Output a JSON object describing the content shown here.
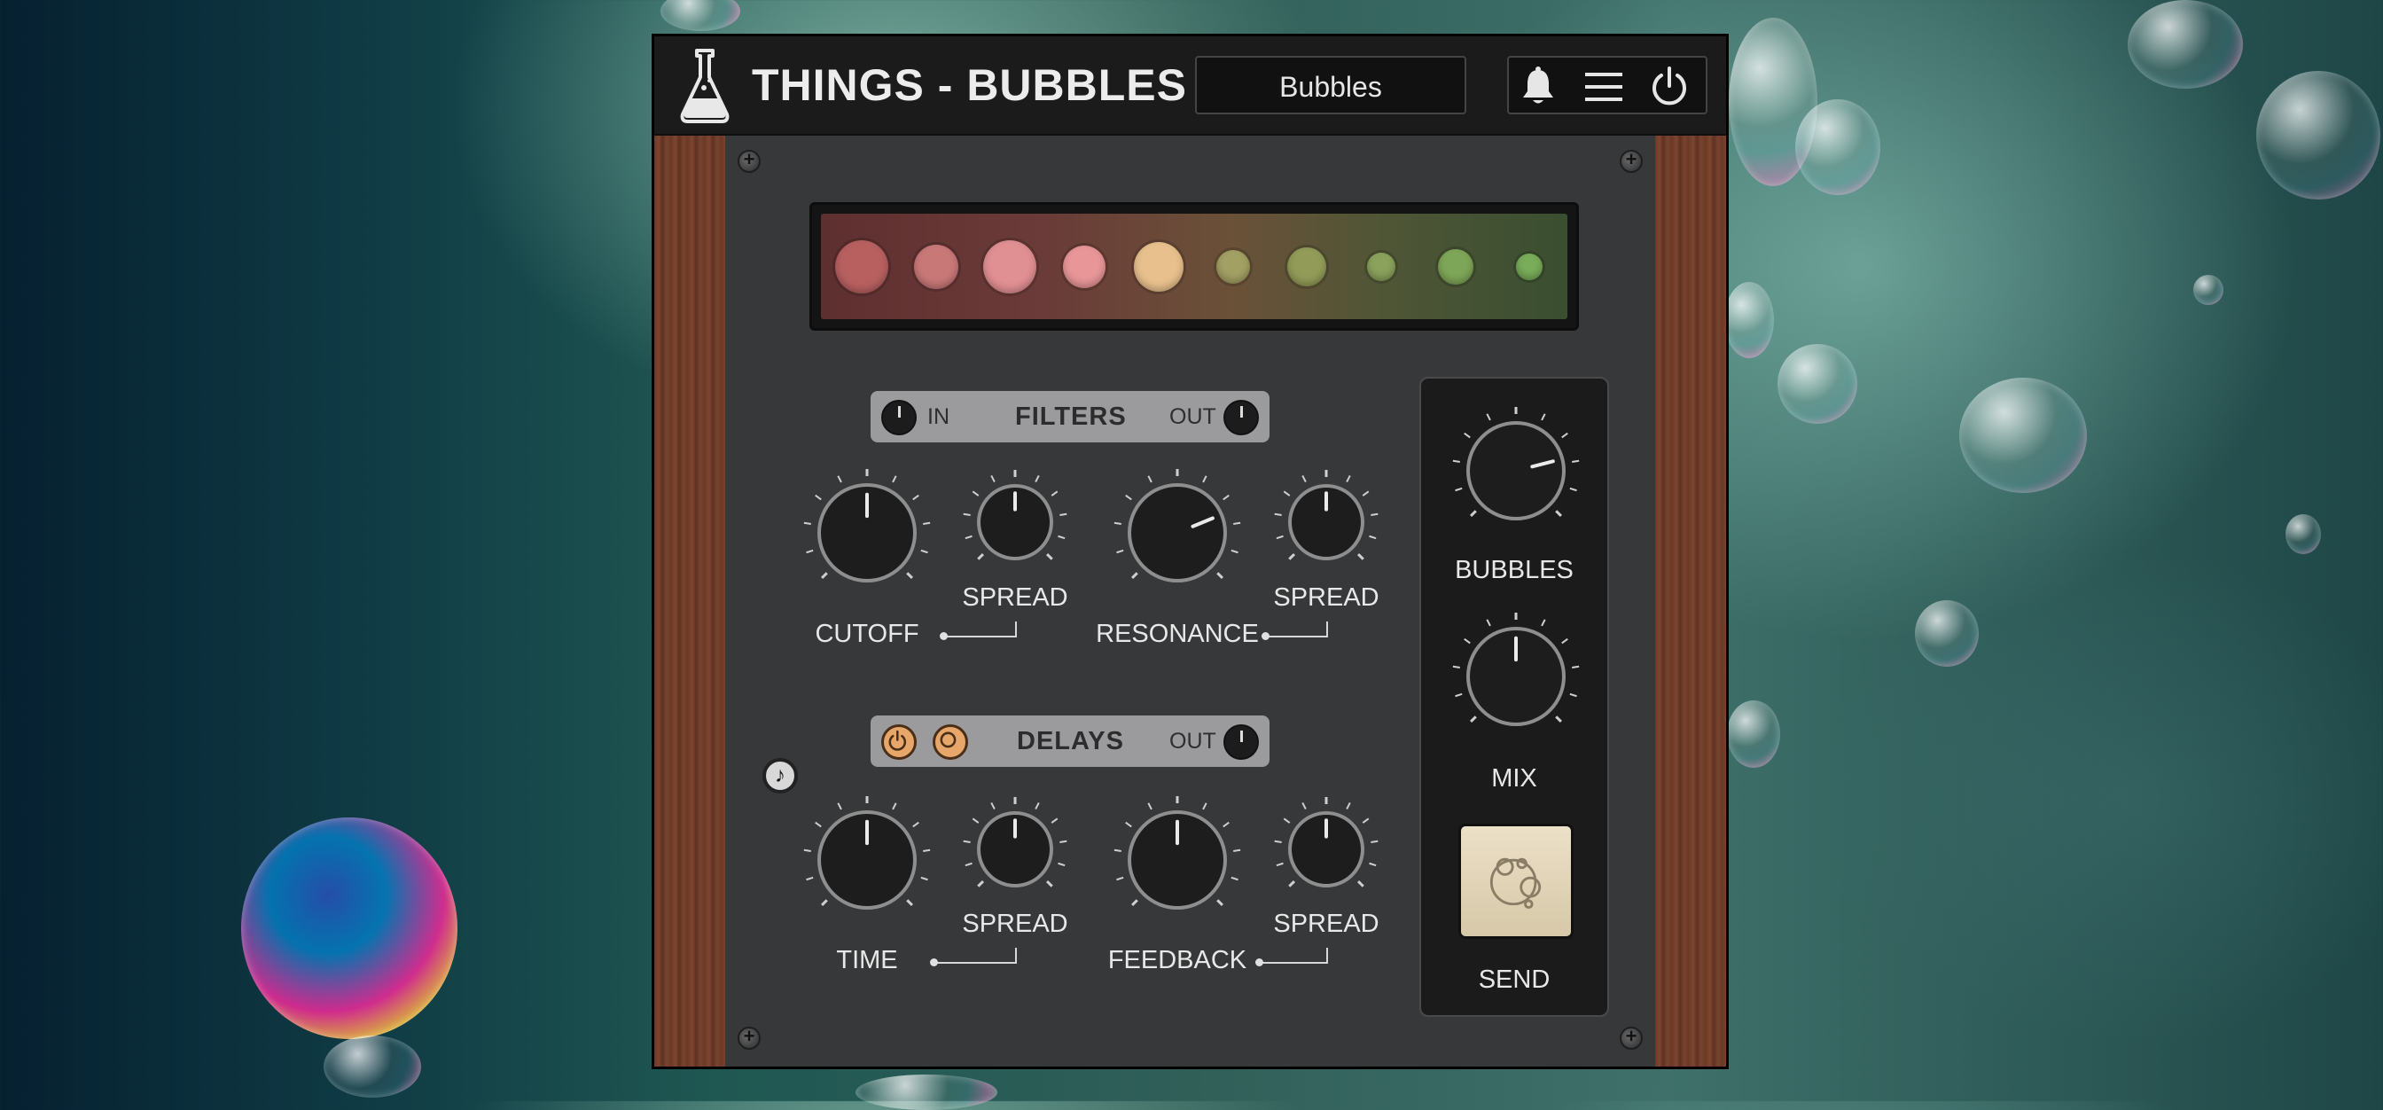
{
  "app": {
    "title": "THINGS - BUBBLES",
    "preset": "Bubbles"
  },
  "header_icons": [
    "bell-icon",
    "menu-icon",
    "power-icon"
  ],
  "display": {
    "dot_colors": [
      "#b86060",
      "#c97878",
      "#e08f93",
      "#e89698",
      "#e8c08d",
      "#a3a064",
      "#929c58",
      "#8ba25d",
      "#7ea658",
      "#79ad5a"
    ]
  },
  "filters": {
    "label": "FILTERS",
    "in_label": "IN",
    "out_label": "OUT",
    "cutoff_label": "CUTOFF",
    "resonance_label": "RESONANCE",
    "spread1_label": "SPREAD",
    "spread2_label": "SPREAD"
  },
  "delays": {
    "label": "DELAYS",
    "out_label": "OUT",
    "time_label": "TIME",
    "feedback_label": "FEEDBACK",
    "spread1_label": "SPREAD",
    "spread2_label": "SPREAD"
  },
  "right": {
    "bubbles_label": "BUBBLES",
    "mix_label": "MIX",
    "send_label": "SEND"
  },
  "note_symbol": "♪",
  "knob_values": {
    "cutoff": 0.5,
    "filter_spread": 0.5,
    "resonance": 0.75,
    "resonance_spread": 0.5,
    "time": 0.5,
    "time_spread": 0.5,
    "feedback": 0.5,
    "feedback_spread": 0.5,
    "bubbles": 0.78,
    "mix": 0.5
  }
}
